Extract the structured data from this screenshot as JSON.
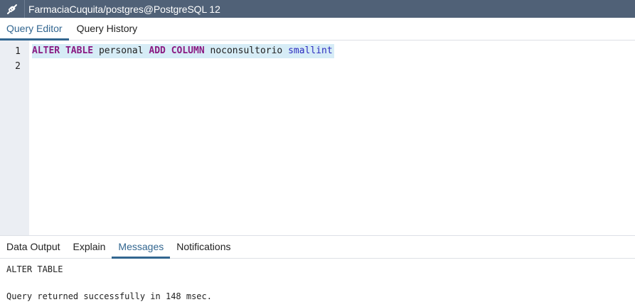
{
  "title_bar": {
    "icon": "server-connection-icon",
    "text": "FarmaciaCuquita/postgres@PostgreSQL 12"
  },
  "editor_tabs": [
    {
      "label": "Query Editor",
      "active": true
    },
    {
      "label": "Query History",
      "active": false
    }
  ],
  "editor": {
    "line_numbers": [
      "1",
      "2"
    ],
    "line1_tokens": {
      "alter": "ALTER",
      "table": "TABLE",
      "table_name": "personal",
      "add": "ADD",
      "column": "COLUMN",
      "column_name": "noconsultorio",
      "type": "smallint"
    }
  },
  "output_tabs": [
    {
      "label": "Data Output",
      "active": false
    },
    {
      "label": "Explain",
      "active": false
    },
    {
      "label": "Messages",
      "active": true
    },
    {
      "label": "Notifications",
      "active": false
    }
  ],
  "messages": {
    "line1": "ALTER TABLE",
    "line2": "Query returned successfully in 148 msec."
  },
  "colors": {
    "title_bar": "#506177",
    "active_tab": "#326690",
    "keyword": "#8a1a82",
    "type": "#2b2bbf",
    "selection": "#d6ecf6"
  }
}
